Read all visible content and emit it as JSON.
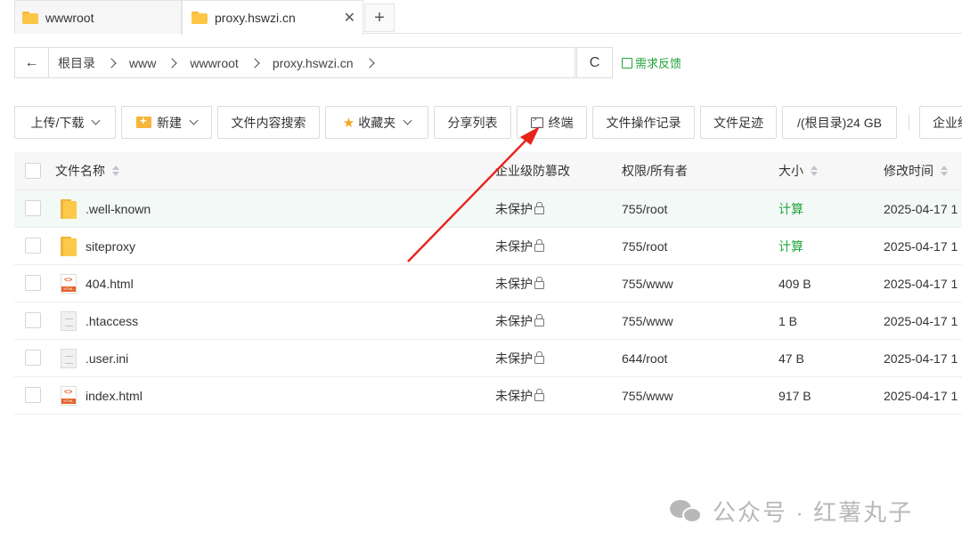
{
  "tabs": [
    {
      "label": "wwwroot",
      "icon": "folder-icon"
    },
    {
      "label": "proxy.hswzi.cn",
      "icon": "folder-icon",
      "close": "✕",
      "active": true
    }
  ],
  "tab_add": "+",
  "path": {
    "back": "←",
    "crumbs": [
      "根目录",
      "www",
      "wwwroot",
      "proxy.hswzi.cn"
    ],
    "refresh": "C"
  },
  "feedback": "需求反馈",
  "toolbar": {
    "upload": "上传/下载",
    "new": "新建",
    "search_content": "文件内容搜索",
    "favorites": "收藏夹",
    "share_list": "分享列表",
    "terminal": "终端",
    "file_ops_log": "文件操作记录",
    "file_trace": "文件足迹",
    "disk": "/(根目录)24 GB",
    "enterprise": "企业级"
  },
  "columns": {
    "name": "文件名称",
    "protect": "企业级防篡改",
    "perm": "权限/所有者",
    "size": "大小",
    "mtime": "修改时间"
  },
  "rows": [
    {
      "name": ".well-known",
      "type": "folder",
      "protect": "未保护",
      "perm": "755/root",
      "size": "计算",
      "mtime": "2025-04-17 1"
    },
    {
      "name": "siteproxy",
      "type": "folder",
      "protect": "未保护",
      "perm": "755/root",
      "size": "计算",
      "mtime": "2025-04-17 1"
    },
    {
      "name": "404.html",
      "type": "html",
      "protect": "未保护",
      "perm": "755/www",
      "size": "409 B",
      "mtime": "2025-04-17 1"
    },
    {
      "name": ".htaccess",
      "type": "doc",
      "protect": "未保护",
      "perm": "755/www",
      "size": "1 B",
      "mtime": "2025-04-17 1"
    },
    {
      "name": ".user.ini",
      "type": "doc",
      "protect": "未保护",
      "perm": "644/root",
      "size": "47 B",
      "mtime": "2025-04-17 1"
    },
    {
      "name": "index.html",
      "type": "html",
      "protect": "未保护",
      "perm": "755/www",
      "size": "917 B",
      "mtime": "2025-04-17 1"
    }
  ],
  "watermark": "公众号 · 红薯丸子",
  "colors": {
    "accent": "#20a53a",
    "arrow": "#e8231c",
    "folder": "#fbc546",
    "row_highlight": "#f3f9f7"
  }
}
